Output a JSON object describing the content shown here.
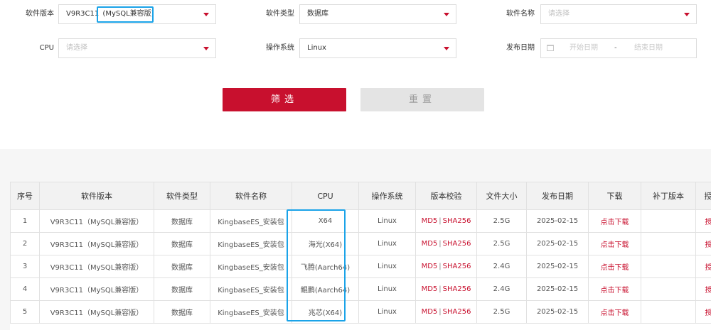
{
  "filters": {
    "software_version": {
      "label": "软件版本",
      "value_main": "V9R3C11",
      "value_highlight": "(MySQL兼容版)"
    },
    "software_type": {
      "label": "软件类型",
      "value": "数据库"
    },
    "software_name": {
      "label": "软件名称",
      "placeholder": "请选择"
    },
    "cpu": {
      "label": "CPU",
      "placeholder": "请选择"
    },
    "os": {
      "label": "操作系统",
      "value": "Linux"
    },
    "release_date": {
      "label": "发布日期",
      "start_placeholder": "开始日期",
      "separator": "-",
      "end_placeholder": "结束日期"
    }
  },
  "buttons": {
    "filter_label": "筛选",
    "reset_label": "重置"
  },
  "table": {
    "headers": [
      "序号",
      "软件版本",
      "软件类型",
      "软件名称",
      "CPU",
      "操作系统",
      "版本校验",
      "文件大小",
      "发布日期",
      "下载",
      "补丁版本",
      "授权"
    ],
    "md5_label": "MD5",
    "check_sep": "|",
    "sha_label": "SHA256",
    "rows": [
      {
        "no": "1",
        "version": "V9R3C11（MySQL兼容版）",
        "type": "数据库",
        "name": "KingbaseES_安装包",
        "cpu": "X64",
        "os": "Linux",
        "size": "2.5G",
        "date": "2025-02-15",
        "download": "点击下载",
        "patch": "",
        "auth": "授权"
      },
      {
        "no": "2",
        "version": "V9R3C11（MySQL兼容版）",
        "type": "数据库",
        "name": "KingbaseES_安装包",
        "cpu": "海光(X64)",
        "os": "Linux",
        "size": "2.5G",
        "date": "2025-02-15",
        "download": "点击下载",
        "patch": "",
        "auth": "授权"
      },
      {
        "no": "3",
        "version": "V9R3C11（MySQL兼容版）",
        "type": "数据库",
        "name": "KingbaseES_安装包",
        "cpu": "飞腾(Aarch64)",
        "os": "Linux",
        "size": "2.4G",
        "date": "2025-02-15",
        "download": "点击下载",
        "patch": "",
        "auth": "授权"
      },
      {
        "no": "4",
        "version": "V9R3C11（MySQL兼容版）",
        "type": "数据库",
        "name": "KingbaseES_安装包",
        "cpu": "鲲鹏(Aarch64)",
        "os": "Linux",
        "size": "2.4G",
        "date": "2025-02-15",
        "download": "点击下载",
        "patch": "",
        "auth": "授权"
      },
      {
        "no": "5",
        "version": "V9R3C11（MySQL兼容版）",
        "type": "数据库",
        "name": "KingbaseES_安装包",
        "cpu": "兆芯(X64)",
        "os": "Linux",
        "size": "2.5G",
        "date": "2025-02-15",
        "download": "点击下载",
        "patch": "",
        "auth": "授权"
      }
    ]
  },
  "colors": {
    "accent_red": "#c8102e",
    "highlight_blue": "#1aa3e8"
  },
  "icons": {
    "dropdown": "caret-down-icon",
    "calendar": "calendar-icon"
  }
}
